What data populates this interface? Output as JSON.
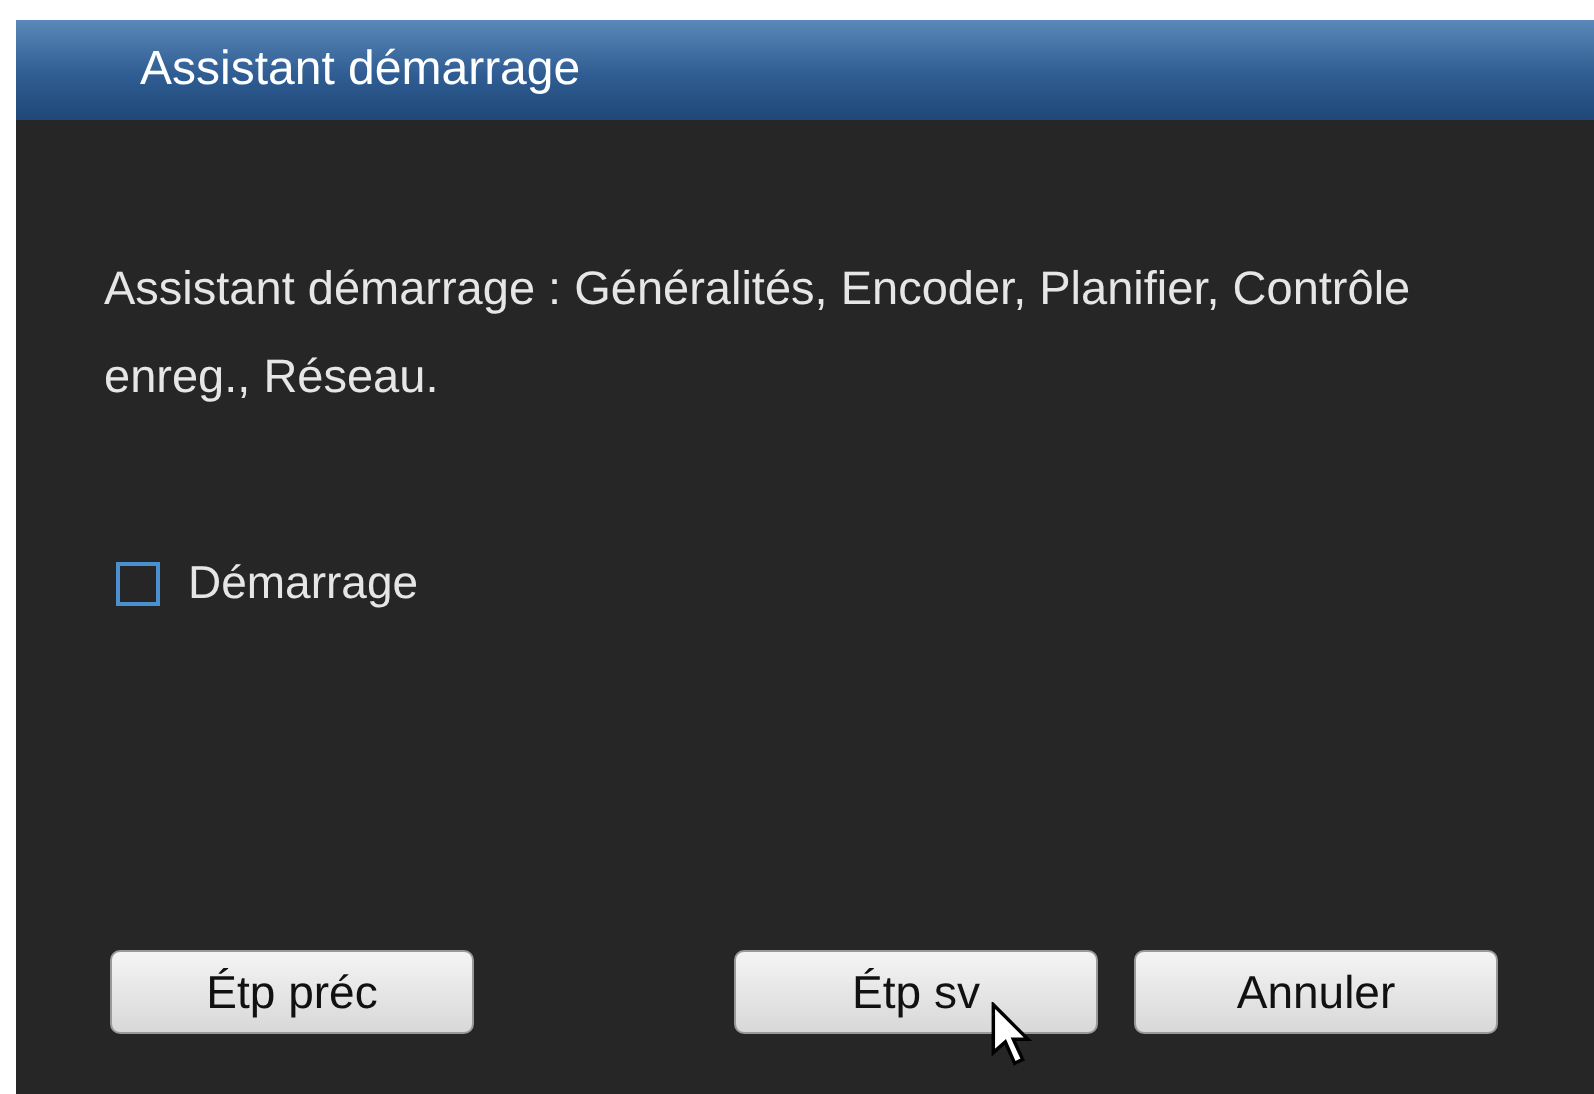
{
  "window": {
    "title": "Assistant démarrage"
  },
  "description": "Assistant démarrage  : Généralités, Encoder, Planifier, Contrôle enreg., Réseau.",
  "checkbox": {
    "label": "Démarrage",
    "checked": false
  },
  "buttons": [
    {
      "label": "Étp préc",
      "hovered": false
    },
    {
      "label": "Étp sv",
      "hovered": true
    },
    {
      "label": "Annuler",
      "hovered": false
    }
  ]
}
